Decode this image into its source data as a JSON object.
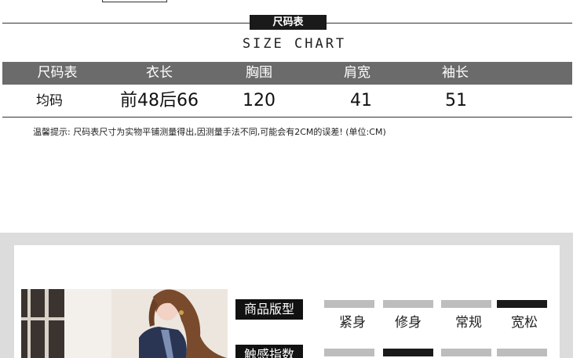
{
  "size_chart": {
    "title_cn": "尺码表",
    "title_en": "SIZE CHART",
    "headers": [
      "尺码表",
      "衣长",
      "胸围",
      "肩宽",
      "袖长"
    ],
    "row": [
      "均码",
      "前48后66",
      "120",
      "41",
      "51"
    ],
    "note": "温馨提示: 尺码表尺寸为实物平铺测量得出,因测量手法不同,可能会有2CM的误差! (单位:CM)"
  },
  "product": {
    "fit_label": "商品版型",
    "fit_options": [
      "紧身",
      "修身",
      "常规",
      "宽松"
    ],
    "fit_selected": "宽松",
    "touch_label": "触感指数"
  },
  "colors": {
    "header_bg": "#6b6b6b",
    "tag_bg": "#1a1a1a",
    "scale_inactive": "#bdbdbd",
    "scale_active": "#1a1a1a",
    "band_bg": "#dcdcdc"
  }
}
